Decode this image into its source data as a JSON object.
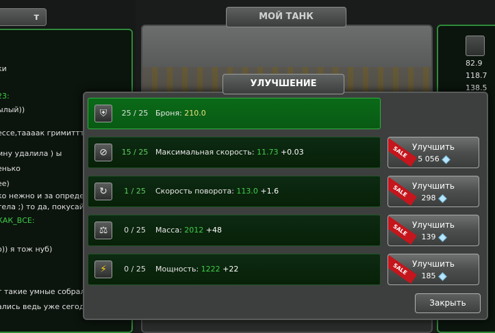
{
  "left_panel": {
    "tab_fragment": "т",
    "chat_lines": [
      {
        "text": "ки",
        "green": false
      },
      {
        "text": "23:",
        "green": true
      },
      {
        "text": "ылый))",
        "green": false
      },
      {
        "text": "ессе,тааaак гримиттт",
        "green": false
      },
      {
        "text": "мну удалила ) ы",
        "green": false
      },
      {
        "text": "енько",
        "green": false
      },
      {
        "text": "ее)",
        "green": false
      },
      {
        "text": "ко нежно и за определе",
        "green": false
      },
      {
        "text": "тела ;) то да, покусай)))",
        "green": false
      },
      {
        "text": "КАК_ВСЕ:",
        "green": true
      },
      {
        "text": "о)) я тож нуб)",
        "green": false
      },
      {
        "text": "т такие умные собрали",
        "green": false
      },
      {
        "text": "ались ведь уже сегодня",
        "green": false
      }
    ]
  },
  "header": {
    "my_tank_tab": "МОЙ ТАНК"
  },
  "right_panel": {
    "stats": [
      "82.9",
      "118.7",
      "138.5"
    ]
  },
  "modal": {
    "title": "УЛУЧШЕНИЕ",
    "close_label": "Закрыть",
    "upgrade_label": "Улучшить",
    "sale_label": "SALE",
    "rows": [
      {
        "icon": "shield-icon",
        "level": "25 / 25",
        "label": "Броня:",
        "value": "210.0",
        "increment": "",
        "price": "",
        "maxed": true
      },
      {
        "icon": "speed-icon",
        "level": "15 / 25",
        "label": "Максимальная скорость:",
        "value": "11.73",
        "increment": "+0.03",
        "price": "5 056",
        "maxed": false
      },
      {
        "icon": "turn-icon",
        "level": "1 / 25",
        "label": "Скорость поворота:",
        "value": "113.0",
        "increment": "+1.6",
        "price": "298",
        "maxed": false
      },
      {
        "icon": "weight-icon",
        "level": "0 / 25",
        "label": "Масса:",
        "value": "2012",
        "increment": "+48",
        "price": "139",
        "maxed": false
      },
      {
        "icon": "lightning-icon",
        "level": "0 / 25",
        "label": "Мощность:",
        "value": "1222",
        "increment": "+22",
        "price": "185",
        "maxed": false
      }
    ]
  }
}
